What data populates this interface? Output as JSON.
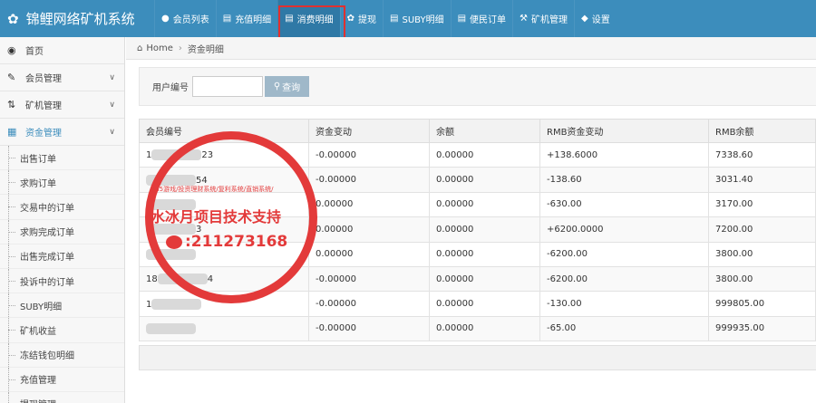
{
  "topbar": {
    "brand": "锦鲤网络矿机系统",
    "items": [
      {
        "label": "会员列表",
        "icon": "user-icon"
      },
      {
        "label": "充值明细",
        "icon": "list-icon"
      },
      {
        "label": "消费明细",
        "icon": "list-icon"
      },
      {
        "label": "提现",
        "icon": "leaf-icon"
      },
      {
        "label": "SUBY明细",
        "icon": "list-icon"
      },
      {
        "label": "便民订单",
        "icon": "list-icon"
      },
      {
        "label": "矿机管理",
        "icon": "wrench-icon"
      },
      {
        "label": "设置",
        "icon": "tag-icon"
      }
    ]
  },
  "sidebar": {
    "items": [
      {
        "label": "首页",
        "icon": "dashboard-icon"
      },
      {
        "label": "会员管理",
        "icon": "edit-icon"
      },
      {
        "label": "矿机管理",
        "icon": "shuffle-icon"
      },
      {
        "label": "资金管理",
        "icon": "calendar-icon"
      }
    ],
    "subitems": [
      "出售订单",
      "求购订单",
      "交易中的订单",
      "求购完成订单",
      "出售完成订单",
      "投诉中的订单",
      "SUBY明细",
      "矿机收益",
      "冻结钱包明细",
      "充值管理",
      "提现管理"
    ]
  },
  "breadcrumb": {
    "home": "Home",
    "current": "资金明细"
  },
  "search": {
    "label": "用户编号",
    "placeholder": "",
    "button": "查询"
  },
  "table": {
    "headers": [
      "会员编号",
      "资金变动",
      "余额",
      "RMB资金变动",
      "RMB余额"
    ],
    "rows": [
      {
        "id_prefix": "1",
        "id_suffix": "23",
        "change": "-0.00000",
        "balance": "0.00000",
        "rmb_change": "+138.6000",
        "rmb_balance": "7338.60"
      },
      {
        "id_prefix": "",
        "id_suffix": "54",
        "change": "-0.00000",
        "balance": "0.00000",
        "rmb_change": "-138.60",
        "rmb_balance": "3031.40"
      },
      {
        "id_prefix": "",
        "id_suffix": "",
        "change": "0.00000",
        "balance": "0.00000",
        "rmb_change": "-630.00",
        "rmb_balance": "3170.00"
      },
      {
        "id_prefix": "",
        "id_suffix": "3",
        "change": "0.00000",
        "balance": "0.00000",
        "rmb_change": "+6200.0000",
        "rmb_balance": "7200.00"
      },
      {
        "id_prefix": "",
        "id_suffix": "",
        "change": "0.00000",
        "balance": "0.00000",
        "rmb_change": "-6200.00",
        "rmb_balance": "3800.00"
      },
      {
        "id_prefix": "18",
        "id_suffix": "4",
        "change": "-0.00000",
        "balance": "0.00000",
        "rmb_change": "-6200.00",
        "rmb_balance": "3800.00"
      },
      {
        "id_prefix": "1",
        "id_suffix": "",
        "change": "-0.00000",
        "balance": "0.00000",
        "rmb_change": "-130.00",
        "rmb_balance": "999805.00"
      },
      {
        "id_prefix": "",
        "id_suffix": "",
        "change": "-0.00000",
        "balance": "0.00000",
        "rmb_change": "-65.00",
        "rmb_balance": "999935.00"
      }
    ]
  },
  "watermark": {
    "line_small": "/H5游戏/投资理财系统/复利系统/直销系统/",
    "line_big": "水冰月项目技术支持",
    "line_num": ":211273168"
  },
  "colors": {
    "nav": "#3c8dbc",
    "stamp": "#e33a3a",
    "highlight": "#e03030"
  }
}
